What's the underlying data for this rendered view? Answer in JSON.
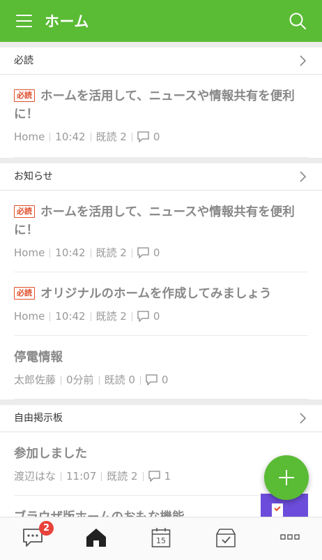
{
  "header": {
    "title": "ホーム",
    "menu_icon": "hamburger-menu-icon",
    "search_icon": "search-icon",
    "color": "#5abb35"
  },
  "sections": [
    {
      "title": "必読",
      "items": [
        {
          "badge": "必読",
          "title_line1": "ホームを活用して、ニュースや情報共有を便利",
          "title_line2": "に！",
          "author": "Home",
          "time": "10:42",
          "read": "既読 2",
          "comments": "0"
        }
      ]
    },
    {
      "title": "お知らせ",
      "items": [
        {
          "badge": "必読",
          "title_line1": "ホームを活用して、ニュースや情報共有を便利",
          "title_line2": "に！",
          "author": "Home",
          "time": "10:42",
          "read": "既読 2",
          "comments": "0"
        },
        {
          "badge": "必読",
          "title_line1": "オリジナルのホームを作成してみましょう",
          "author": "Home",
          "time": "10:42",
          "read": "既読 2",
          "comments": "0"
        },
        {
          "title_line1": "停電情報",
          "author": "太郎佐藤",
          "time": "0分前",
          "read": "既読 0",
          "comments": "0"
        }
      ]
    },
    {
      "title": "自由掲示板",
      "items": [
        {
          "title_line1": "参加しました",
          "author": "渡辺はな",
          "time": "11:07",
          "read": "既読 2",
          "comments": "1"
        },
        {
          "title_line1": "ブラウザ版ホームのおもな機能"
        }
      ]
    }
  ],
  "fab": {
    "icon": "plus-icon"
  },
  "bottom_nav": [
    {
      "name": "chat",
      "icon": "chat-bubble-icon",
      "badge": "2"
    },
    {
      "name": "home",
      "icon": "home-icon",
      "active": true
    },
    {
      "name": "calendar",
      "icon": "calendar-icon",
      "date": "15"
    },
    {
      "name": "tasks",
      "icon": "task-box-icon"
    },
    {
      "name": "more",
      "icon": "more-dots-icon"
    }
  ],
  "colors": {
    "accent": "#5abb35",
    "badge": "#e04f2b",
    "notification": "#e8433b"
  }
}
